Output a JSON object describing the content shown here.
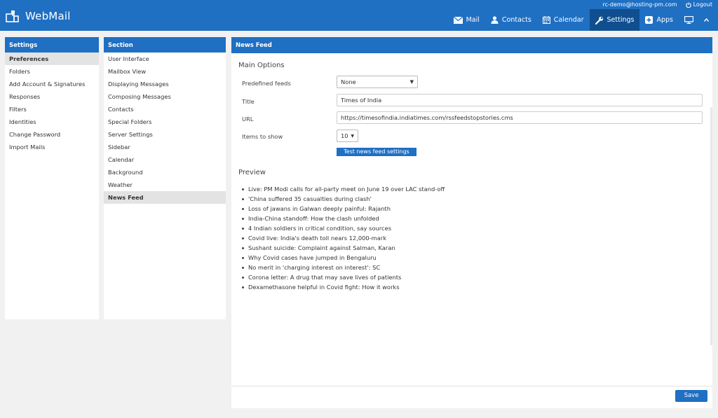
{
  "app": {
    "title": "WebMail"
  },
  "user": {
    "email": "rc-demo@hosting-pm.com",
    "logout_label": "Logout"
  },
  "nav": [
    {
      "label": "Mail",
      "icon": "mail-icon"
    },
    {
      "label": "Contacts",
      "icon": "contacts-icon"
    },
    {
      "label": "Calendar",
      "icon": "calendar-icon"
    },
    {
      "label": "Settings",
      "icon": "wrench-icon",
      "active": true
    },
    {
      "label": "Apps",
      "icon": "plus-square-icon"
    }
  ],
  "settings": {
    "header": "Settings",
    "items": [
      "Preferences",
      "Folders",
      "Add Account & Signatures",
      "Responses",
      "Filters",
      "Identities",
      "Change Password",
      "Import Mails"
    ],
    "selected": "Preferences"
  },
  "section": {
    "header": "Section",
    "items": [
      "User Interface",
      "Mailbox View",
      "Displaying Messages",
      "Composing Messages",
      "Contacts",
      "Special Folders",
      "Server Settings",
      "Sidebar",
      "Calendar",
      "Background",
      "Weather",
      "News Feed"
    ],
    "selected": "News Feed"
  },
  "content": {
    "header": "News Feed",
    "main_options_title": "Main Options",
    "fields": {
      "predefined_label": "Predefined feeds",
      "predefined_value": "None",
      "title_label": "Title",
      "title_value": "Times of India",
      "url_label": "URL",
      "url_value": "https://timesofindia.indiatimes.com/rssfeedstopstories.cms",
      "items_label": "Items to show",
      "items_value": "10"
    },
    "test_button": "Test news feed settings",
    "preview_title": "Preview",
    "preview_items": [
      "Live: PM Modi calls for all-party meet on June 19 over LAC stand-off",
      "'China suffered 35 casualties during clash'",
      "Loss of jawans in Galwan deeply painful: Rajanth",
      "India-China standoff: How the clash unfolded",
      "4 Indian soldiers in critical condition, say sources",
      "Covid live: India's death toll nears 12,000-mark",
      "Sushant suicide: Complaint against Salman, Karan",
      "Why Covid cases have jumped in Bengaluru",
      "No merit in 'charging interest on interest': SC",
      "Corona letter: A drug that may save lives of patients",
      "Dexamethasone helpful in Covid fight: How it works"
    ],
    "save_button": "Save"
  },
  "colors": {
    "brand": "#1f6fc3",
    "brand_dark": "#0f4f8f"
  }
}
